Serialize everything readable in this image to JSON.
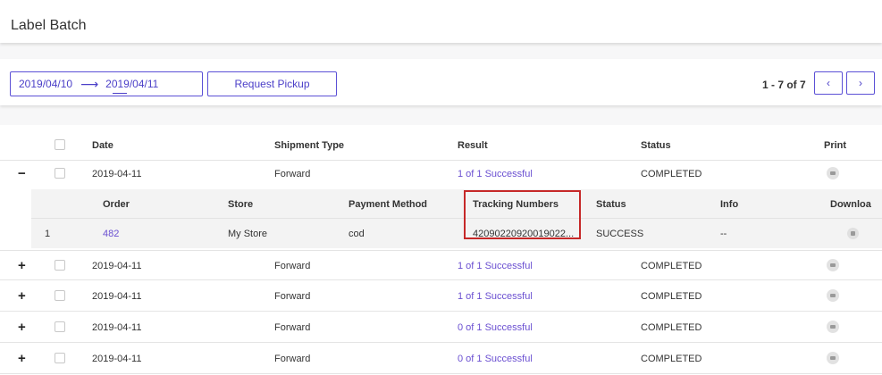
{
  "header": {
    "title": "Label Batch"
  },
  "toolbar": {
    "date_from": "2019/04/10",
    "date_to": "2019/04/11",
    "request_pickup_label": "Request Pickup",
    "pagination": "1 - 7 of 7",
    "prev_icon": "chevron-left-icon",
    "next_icon": "chevron-right-icon"
  },
  "table": {
    "columns": [
      "Date",
      "Shipment Type",
      "Result",
      "Status",
      "Print"
    ],
    "rows": [
      {
        "toggle": "−",
        "date": "2019-04-11",
        "type": "Forward",
        "result": "1 of 1 Successful",
        "status": "COMPLETED",
        "expanded": true
      },
      {
        "toggle": "+",
        "date": "2019-04-11",
        "type": "Forward",
        "result": "1 of 1 Successful",
        "status": "COMPLETED"
      },
      {
        "toggle": "+",
        "date": "2019-04-11",
        "type": "Forward",
        "result": "1 of 1 Successful",
        "status": "COMPLETED"
      },
      {
        "toggle": "+",
        "date": "2019-04-11",
        "type": "Forward",
        "result": "0 of 1 Successful",
        "status": "COMPLETED"
      },
      {
        "toggle": "+",
        "date": "2019-04-11",
        "type": "Forward",
        "result": "0 of 1 Successful",
        "status": "COMPLETED"
      }
    ]
  },
  "subtable": {
    "columns": [
      "Order",
      "Store",
      "Payment Method",
      "Tracking Numbers",
      "Status",
      "Info",
      "Downloa"
    ],
    "rows": [
      {
        "index": "1",
        "order": "482",
        "store": "My Store",
        "payment": "cod",
        "tracking": "42090220920019022...",
        "status": "SUCCESS",
        "info": "--"
      }
    ]
  },
  "colors": {
    "accent": "#5b50d6",
    "link": "#6a4fd1",
    "highlight": "#c62828"
  }
}
